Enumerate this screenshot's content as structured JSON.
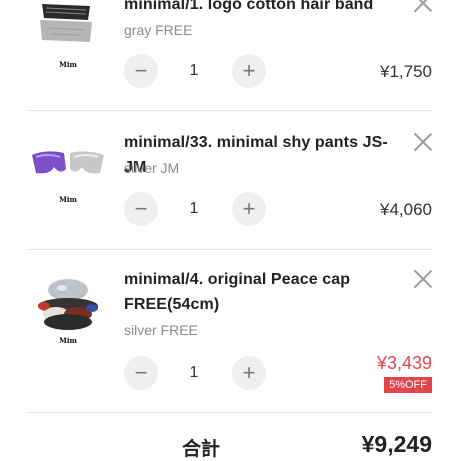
{
  "cart": {
    "items": [
      {
        "name": "minimal/1. logo cotton hair band",
        "variant": "gray FREE",
        "quantity": "1",
        "price": "¥1,750",
        "brand_mark": "Mim",
        "minus": "−",
        "plus": "+"
      },
      {
        "name": "minimal/33. minimal shy pants JS-JM",
        "variant": "silver JM",
        "quantity": "1",
        "price": "¥4,060",
        "brand_mark": "Mim",
        "minus": "−",
        "plus": "+"
      },
      {
        "name": "minimal/4. original Peace cap FREE(54cm)",
        "variant": "silver FREE",
        "quantity": "1",
        "price": "¥3,439",
        "discount_badge": "5%OFF",
        "brand_mark": "Mim",
        "minus": "−",
        "plus": "+"
      }
    ],
    "total_label": "合計",
    "total_value": "¥9,249"
  },
  "colors": {
    "sale": "#e0474c",
    "muted": "#8a8a8a",
    "button_bg": "#efefef"
  },
  "icons": [
    "close-icon",
    "minus-icon",
    "plus-icon"
  ]
}
